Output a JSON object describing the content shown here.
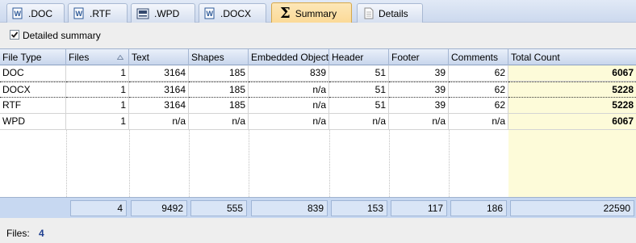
{
  "tabs": [
    {
      "label": ".DOC",
      "icon": "word-doc-icon"
    },
    {
      "label": ".RTF",
      "icon": "word-doc-icon"
    },
    {
      "label": ".WPD",
      "icon": "wpd-doc-icon"
    },
    {
      "label": ".DOCX",
      "icon": "word-doc-icon"
    },
    {
      "label": "Summary",
      "icon": "sigma-icon",
      "active": true
    },
    {
      "label": "Details",
      "icon": "document-icon"
    }
  ],
  "options": {
    "detailed_summary_label": "Detailed summary",
    "detailed_summary_checked": true
  },
  "table": {
    "columns": [
      "File Type",
      "Files",
      "Text",
      "Shapes",
      "Embedded Objects",
      "Header",
      "Footer",
      "Comments",
      "Total Count"
    ],
    "sorted_column": "Files",
    "rows": [
      [
        "DOC",
        "1",
        "3164",
        "185",
        "839",
        "51",
        "39",
        "62",
        "6067"
      ],
      [
        "DOCX",
        "1",
        "3164",
        "185",
        "n/a",
        "51",
        "39",
        "62",
        "5228"
      ],
      [
        "RTF",
        "1",
        "3164",
        "185",
        "n/a",
        "51",
        "39",
        "62",
        "5228"
      ],
      [
        "WPD",
        "1",
        "n/a",
        "n/a",
        "n/a",
        "n/a",
        "n/a",
        "n/a",
        "6067"
      ]
    ],
    "selected_row": 1,
    "totals": [
      "4",
      "9492",
      "555",
      "839",
      "153",
      "117",
      "186",
      "22590"
    ]
  },
  "status": {
    "files_label": "Files:",
    "files_value": "4"
  },
  "colors": {
    "total_column_bg": "#fdfbd9",
    "active_tab_bg": "#fbd996",
    "footer_bg": "#c7d8f1",
    "status_value": "#1f3f8f"
  }
}
